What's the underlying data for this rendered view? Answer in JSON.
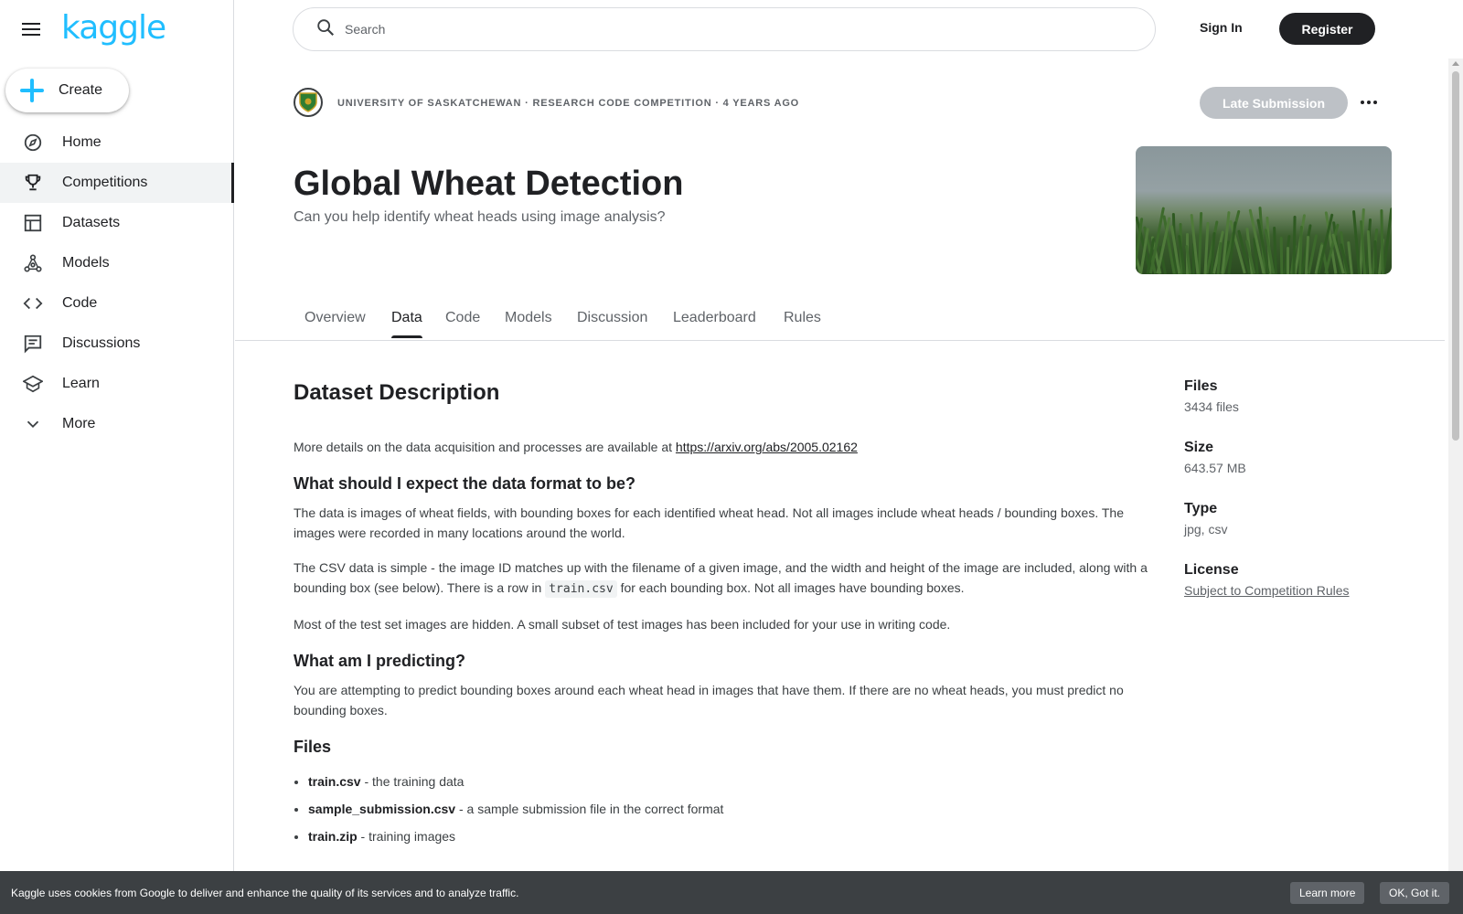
{
  "app": {
    "logo": "kaggle"
  },
  "sidebar": {
    "create_label": "Create",
    "items": [
      {
        "label": "Home",
        "icon": "compass-icon"
      },
      {
        "label": "Competitions",
        "icon": "trophy-icon",
        "active": true
      },
      {
        "label": "Datasets",
        "icon": "table-icon"
      },
      {
        "label": "Models",
        "icon": "models-icon"
      },
      {
        "label": "Code",
        "icon": "code-icon"
      },
      {
        "label": "Discussions",
        "icon": "comments-icon"
      },
      {
        "label": "Learn",
        "icon": "school-icon"
      },
      {
        "label": "More",
        "icon": "chevron-down-icon"
      }
    ]
  },
  "header": {
    "search_placeholder": "Search",
    "signin": "Sign In",
    "register": "Register"
  },
  "competition": {
    "meta": "UNIVERSITY OF SASKATCHEWAN · RESEARCH CODE COMPETITION · 4 YEARS AGO",
    "late_submission": "Late Submission",
    "title": "Global Wheat Detection",
    "subtitle": "Can you help identify wheat heads using image analysis?",
    "tabs": [
      "Overview",
      "Data",
      "Code",
      "Models",
      "Discussion",
      "Leaderboard",
      "Rules"
    ],
    "active_tab": "Data"
  },
  "description": {
    "heading": "Dataset Description",
    "intro": "More details on the data acquisition and processes are available at ",
    "intro_link": "https://arxiv.org/abs/2005.02162",
    "h_format": "What should I expect the data format to be?",
    "p_format1": "The data is images of wheat fields, with bounding boxes for each identified wheat head. Not all images include wheat heads / bounding boxes. The images were recorded in many locations around the world.",
    "p_format2_a": "The CSV data is simple - the image ID matches up with the filename of a given image, and the width and height of the image are included, along with a bounding box (see below). There is a row in ",
    "p_format2_code": "train.csv",
    "p_format2_b": " for each bounding box. Not all images have bounding boxes.",
    "p_format3": "Most of the test set images are hidden. A small subset of test images has been included for your use in writing code.",
    "h_predict": "What am I predicting?",
    "p_predict": "You are attempting to predict bounding boxes around each wheat head in images that have them. If there are no wheat heads, you must predict no bounding boxes.",
    "h_files": "Files",
    "files": [
      {
        "name": "train.csv",
        "desc": " - the training data"
      },
      {
        "name": "sample_submission.csv",
        "desc": " - a sample submission file in the correct format"
      },
      {
        "name": "train.zip",
        "desc": " - training images"
      }
    ]
  },
  "meta": {
    "files_label": "Files",
    "files_value": "3434 files",
    "size_label": "Size",
    "size_value": "643.57 MB",
    "type_label": "Type",
    "type_value": "jpg, csv",
    "license_label": "License",
    "license_value": "Subject to Competition Rules"
  },
  "cookie": {
    "text": "Kaggle uses cookies from Google to deliver and enhance the quality of its services and to analyze traffic.",
    "learn_more": "Learn more",
    "ok": "OK, Got it."
  },
  "colors": {
    "brand": "#20beff",
    "dark": "#202124",
    "disabled": "#bdc1c6"
  }
}
